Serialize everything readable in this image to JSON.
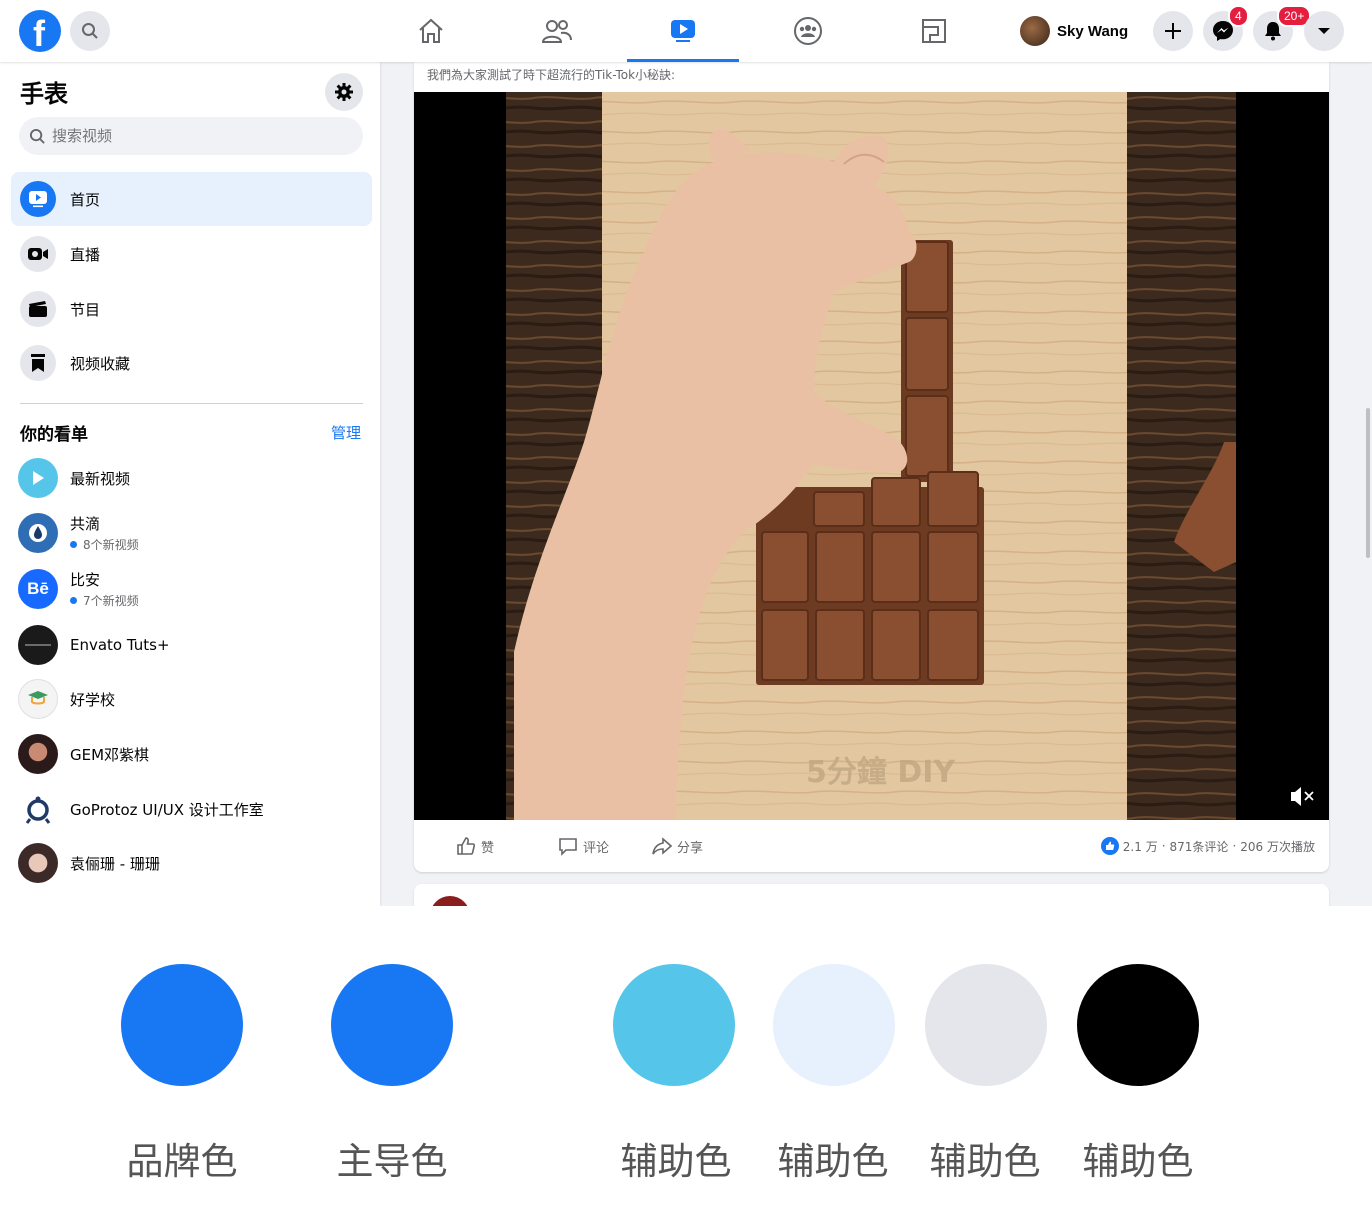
{
  "topbar": {
    "profile_name": "Sky Wang",
    "messenger_badge": "4",
    "notifications_badge": "20+",
    "nav_tabs": [
      "home",
      "friends",
      "watch",
      "groups",
      "gaming"
    ],
    "active_tab": "watch"
  },
  "sidebar": {
    "title": "手表",
    "search_placeholder": "搜索视频",
    "items": [
      {
        "label": "首页",
        "icon": "watch-home-icon",
        "active": true
      },
      {
        "label": "直播",
        "icon": "live-camera-icon",
        "active": false
      },
      {
        "label": "节目",
        "icon": "clapperboard-icon",
        "active": false
      },
      {
        "label": "视频收藏",
        "icon": "bookmark-icon",
        "active": false
      }
    ],
    "watchlist": {
      "heading": "你的看单",
      "manage_label": "管理",
      "items": [
        {
          "name": "最新视频",
          "sub": ""
        },
        {
          "name": "共滴",
          "sub": "8个新视频"
        },
        {
          "name": "比安",
          "sub": "7个新视频"
        },
        {
          "name": "Envato Tuts+",
          "sub": ""
        },
        {
          "name": "好学校",
          "sub": ""
        },
        {
          "name": "GEM邓紫棋",
          "sub": ""
        },
        {
          "name": "GoProtoz UI/UX 设计工作室",
          "sub": ""
        },
        {
          "name": "袁俪珊 - 珊珊",
          "sub": ""
        }
      ]
    }
  },
  "post": {
    "caption": "我們為大家測試了時下超流行的Tik-Tok小秘訣:",
    "watermark": "5分鐘 DIY",
    "actions": {
      "like": "赞",
      "comment": "评论",
      "share": "分享"
    },
    "stats": {
      "likes": "2.1 万",
      "comments": "871条评论",
      "views": "206 万次播放"
    }
  },
  "palette": [
    {
      "label": "品牌色",
      "color": "#1877f2"
    },
    {
      "label": "主导色",
      "color": "#1877f2"
    },
    {
      "label": "辅助色",
      "color": "#55c5ea"
    },
    {
      "label": "辅助色",
      "color": "#e7f0fd"
    },
    {
      "label": "辅助色",
      "color": "#e4e6eb"
    },
    {
      "label": "辅助色",
      "color": "#000000"
    }
  ]
}
